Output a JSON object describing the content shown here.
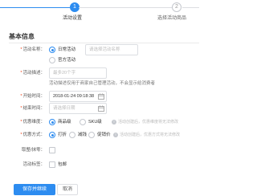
{
  "steps": [
    {
      "number": "1",
      "label": "活动设置",
      "state": "active"
    },
    {
      "number": "2",
      "label": "选择活动商品",
      "state": "idle"
    }
  ],
  "section_title": "基本信息",
  "form": {
    "activity_name": {
      "label": "活动名称：",
      "options": [
        "日常活动",
        "官方活动"
      ],
      "selected": "日常活动",
      "placeholder": "请选择活动名称"
    },
    "activity_desc": {
      "label": "活动描述：",
      "placeholder": "最多20个字",
      "hint": "活动描述仅用于商家自己管理活动，不会显示给消费者"
    },
    "start_time": {
      "label": "开始时间：",
      "value": "2018-01-24 09:18:38"
    },
    "end_time": {
      "label": "结束时间：",
      "placeholder": "请选择日期"
    },
    "discount_dimension": {
      "label": "优惠维度：",
      "options": [
        "商品级",
        "SKU级"
      ],
      "selected": "商品级",
      "warning": "活动创建后，优惠维度将无法修改"
    },
    "discount_method": {
      "label": "优惠方式：",
      "options": [
        "打折",
        "减钱",
        "促销价"
      ],
      "selected": "打折",
      "warning": "活动创建后，优惠方式将无法修改"
    },
    "rounding": {
      "label": "取整/抹零："
    },
    "activity_tag": {
      "label": "活动标签：",
      "option": "包邮"
    }
  },
  "buttons": {
    "save": "保存并继续",
    "cancel": "取消"
  },
  "colors": {
    "primary": "#2d8cf0",
    "required": "#ed4014"
  }
}
